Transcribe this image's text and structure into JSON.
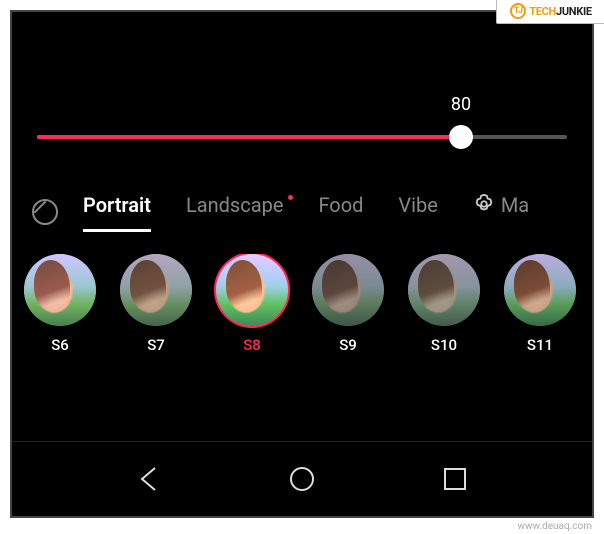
{
  "watermark": {
    "brand_tech": "TECH",
    "brand_junkie": "JUNKIE",
    "brand_logo_letter": "TJ"
  },
  "source_url": "www.deuaq.com",
  "slider": {
    "value": 80,
    "value_label": "80",
    "percent": 80
  },
  "tabs": {
    "items": [
      {
        "label": "Portrait",
        "active": true,
        "dot": false
      },
      {
        "label": "Landscape",
        "active": false,
        "dot": true
      },
      {
        "label": "Food",
        "active": false,
        "dot": false
      },
      {
        "label": "Vibe",
        "active": false,
        "dot": false
      },
      {
        "label": "Ma",
        "active": false,
        "dot": false,
        "has_gear": true
      }
    ]
  },
  "filters": {
    "items": [
      {
        "label": "S6",
        "selected": false,
        "tint": "tint-s6"
      },
      {
        "label": "S7",
        "selected": false,
        "tint": "tint-s7"
      },
      {
        "label": "S8",
        "selected": true,
        "tint": "tint-s8"
      },
      {
        "label": "S9",
        "selected": false,
        "tint": "tint-s9"
      },
      {
        "label": "S10",
        "selected": false,
        "tint": "tint-s10"
      },
      {
        "label": "S11",
        "selected": false,
        "tint": "tint-s11"
      }
    ]
  },
  "colors": {
    "accent": "#ff2d55",
    "text_secondary": "#888"
  }
}
